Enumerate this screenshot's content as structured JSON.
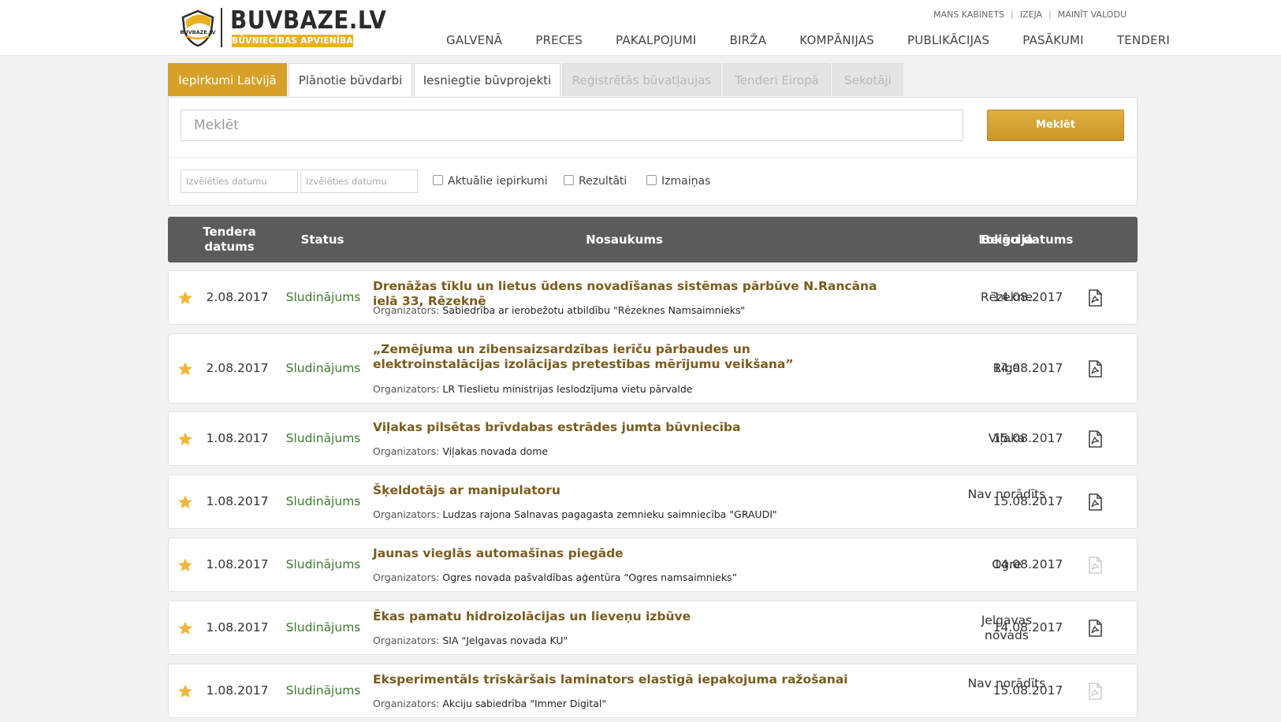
{
  "header": {
    "logo_text": "BUVBAZE.LV",
    "logo_subtitle": "BŪVNIECĪBAS APVIENĪBA",
    "logo_mark_text": "BUVBAZE.LV",
    "top_links": [
      "MANS KABINETS",
      "IZEJA",
      "MAINĪT VALODU"
    ],
    "nav": [
      "GALVENĀ",
      "PRECES",
      "PAKALPOJUMI",
      "BIRŽA",
      "KOMPĀNIJAS",
      "PUBLIKĀCIJAS",
      "PASĀKUMI",
      "TENDERI"
    ]
  },
  "tabs": [
    {
      "label": "Iepirkumi Latvijā",
      "state": "active"
    },
    {
      "label": "Plānotie būvdarbi",
      "state": "normal"
    },
    {
      "label": "Iesniegtie būvprojekti",
      "state": "normal"
    },
    {
      "label": "Reģistrētās būvatļaujas",
      "state": "disabled"
    },
    {
      "label": "Tenderi Eiropā",
      "state": "disabled"
    },
    {
      "label": "Sekotāji",
      "state": "disabled"
    }
  ],
  "search": {
    "placeholder": "Meklēt",
    "button_label": "Meklēt",
    "date_from_placeholder": "Izvēlēties datumu",
    "date_to_placeholder": "Izvēlēties datumu",
    "checkboxes": [
      {
        "label": "Aktuālie iepirkumi",
        "checked": false
      },
      {
        "label": "Rezultāti",
        "checked": false
      },
      {
        "label": "Izmaiņas",
        "checked": false
      }
    ]
  },
  "table": {
    "columns": {
      "tender_date": "Tendera datums",
      "status": "Status",
      "name": "Nosaukums",
      "location": "Lokācija",
      "end_date": "Beigu datums"
    },
    "organizer_label": "Organizators:",
    "rows": [
      {
        "date": "2.08.2017",
        "status": "Sludinājums",
        "title": "Drenāžas tīklu un lietus ūdens novadīšanas sistēmas pārbūve N.Rancāna ielā 33, Rēzeknē",
        "organizer": "Sabiedrība ar ierobežotu atbildību \"Rēzeknes Namsaimnieks\"",
        "location": "Rēzekne",
        "end_date": "14.08.2017",
        "pdf_available": true
      },
      {
        "date": "2.08.2017",
        "status": "Sludinājums",
        "title": "„Zemējuma un zibensaizsardzības ierīču pārbaudes un elektroinstalācijas izolācijas pretestības mērījumu veikšana”",
        "organizer": "LR Tieslietu ministrijas Ieslodzījuma vietu pārvalde",
        "location": "Rīga",
        "end_date": "14.08.2017",
        "pdf_available": true
      },
      {
        "date": "1.08.2017",
        "status": "Sludinājums",
        "title": "Viļakas pilsētas brīvdabas estrādes jumta būvniecība",
        "organizer": "Viļakas novada dome",
        "location": "Viļaka",
        "end_date": "15.08.2017",
        "pdf_available": true
      },
      {
        "date": "1.08.2017",
        "status": "Sludinājums",
        "title": "Šķeldotājs ar manipulatoru",
        "organizer": "Ludzas rajona Salnavas pagagasta zemnieku saimniecība \"GRAUDI\"",
        "location": "Nav norādīts",
        "end_date": "15.08.2017",
        "pdf_available": true
      },
      {
        "date": "1.08.2017",
        "status": "Sludinājums",
        "title": "Jaunas vieglās automašīnas piegāde",
        "organizer": "Ogres novada pašvaldības aģentūra “Ogres namsaimnieks”",
        "location": "Ogre",
        "end_date": "14.08.2017",
        "pdf_available": false
      },
      {
        "date": "1.08.2017",
        "status": "Sludinājums",
        "title": "Ēkas pamatu hidroizolācijas un lieveņu izbūve",
        "organizer": "SIA \"Jelgavas novada KU\"",
        "location": "Jelgavas novads",
        "end_date": "14.08.2017",
        "pdf_available": true
      },
      {
        "date": "1.08.2017",
        "status": "Sludinājums",
        "title": "Eksperimentāls trīskāršais laminators elastīgā iepakojuma ražošanai",
        "organizer": "Akciju sabiedrība \"Immer Digital\"",
        "location": "Nav norādīts",
        "end_date": "15.08.2017",
        "pdf_available": false
      }
    ]
  },
  "colors": {
    "accent": "#d6a02a",
    "status_green": "#3f7a2f",
    "title_brown": "#7a5c1e",
    "star": "#f2b63a",
    "table_header": "#5b5b5b"
  }
}
